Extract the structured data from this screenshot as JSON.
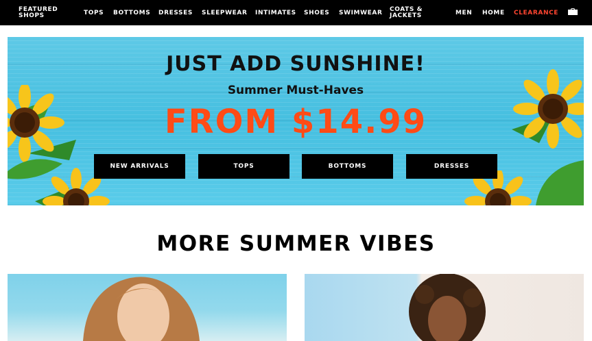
{
  "nav": {
    "featured": "FEATURED SHOPS",
    "tops": "TOPS",
    "bottoms": "BOTTOMS",
    "dresses": "DRESSES",
    "sleepwear": "SLEEPWEAR",
    "intimates": "INTIMATES",
    "shoes": "SHOES",
    "swimwear": "SWIMWEAR",
    "coats": "COATS & JACKETS",
    "men": "MEN",
    "home": "HOME",
    "clearance": "CLEARANCE",
    "bag_icon": "shopping-bag-icon"
  },
  "hero": {
    "title": "JUST ADD SUNSHINE!",
    "subtitle": "Summer Must-Haves",
    "price": "FROM $14.99",
    "buttons": [
      "NEW ARRIVALS",
      "TOPS",
      "BOTTOMS",
      "DRESSES"
    ]
  },
  "section": {
    "title": "MORE SUMMER VIBES"
  },
  "colors": {
    "nav_bg": "#000000",
    "clearance": "#ff4530",
    "hero_bg": "#46bfe0",
    "price": "#ff4b16"
  }
}
